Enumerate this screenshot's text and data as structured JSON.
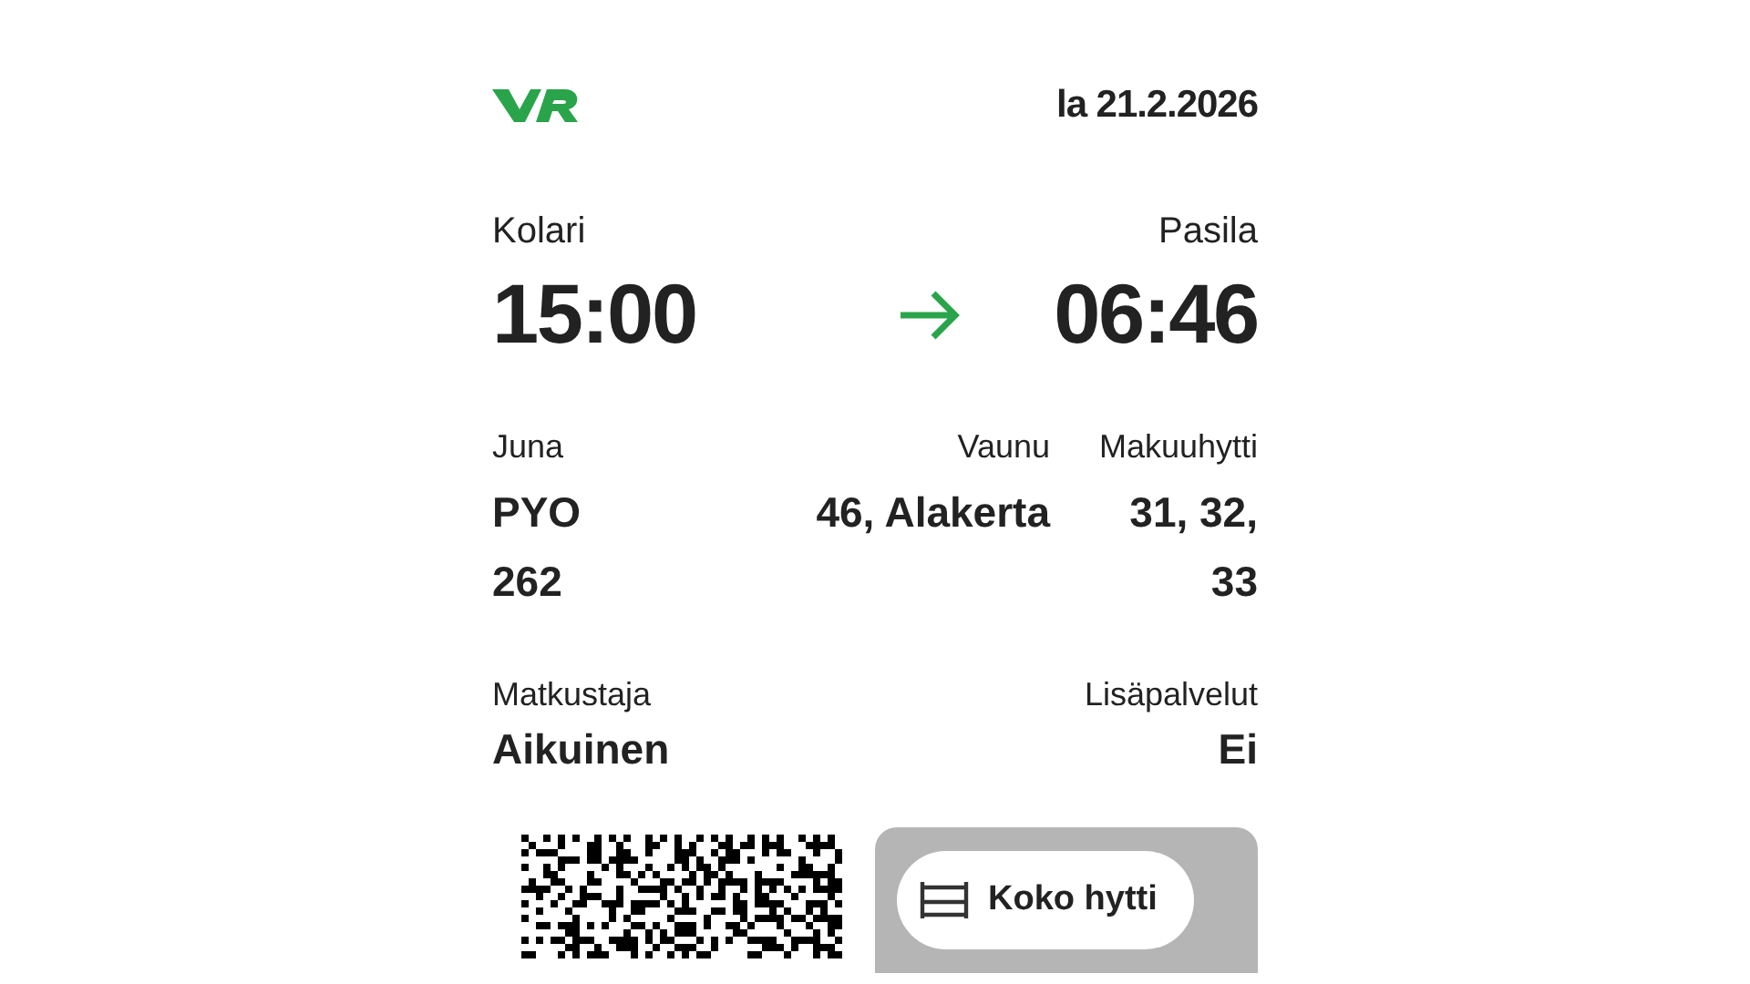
{
  "header": {
    "date": "la 21.2.2026"
  },
  "route": {
    "from": "Kolari",
    "departure": "15:00",
    "to": "Pasila",
    "arrival": "06:46"
  },
  "details": [
    {
      "label": "Juna",
      "value": "PYO 262"
    },
    {
      "label": "Vaunu",
      "value": "46, Alakerta"
    },
    {
      "label": "Makuuhytti",
      "value": "31, 32, 33"
    }
  ],
  "passenger": [
    {
      "label": "Matkustaja",
      "value": "Aikuinen"
    },
    {
      "label": "Lisäpalvelut",
      "value": "Ei"
    }
  ],
  "cabin_badge": {
    "label": "Koko hytti"
  }
}
